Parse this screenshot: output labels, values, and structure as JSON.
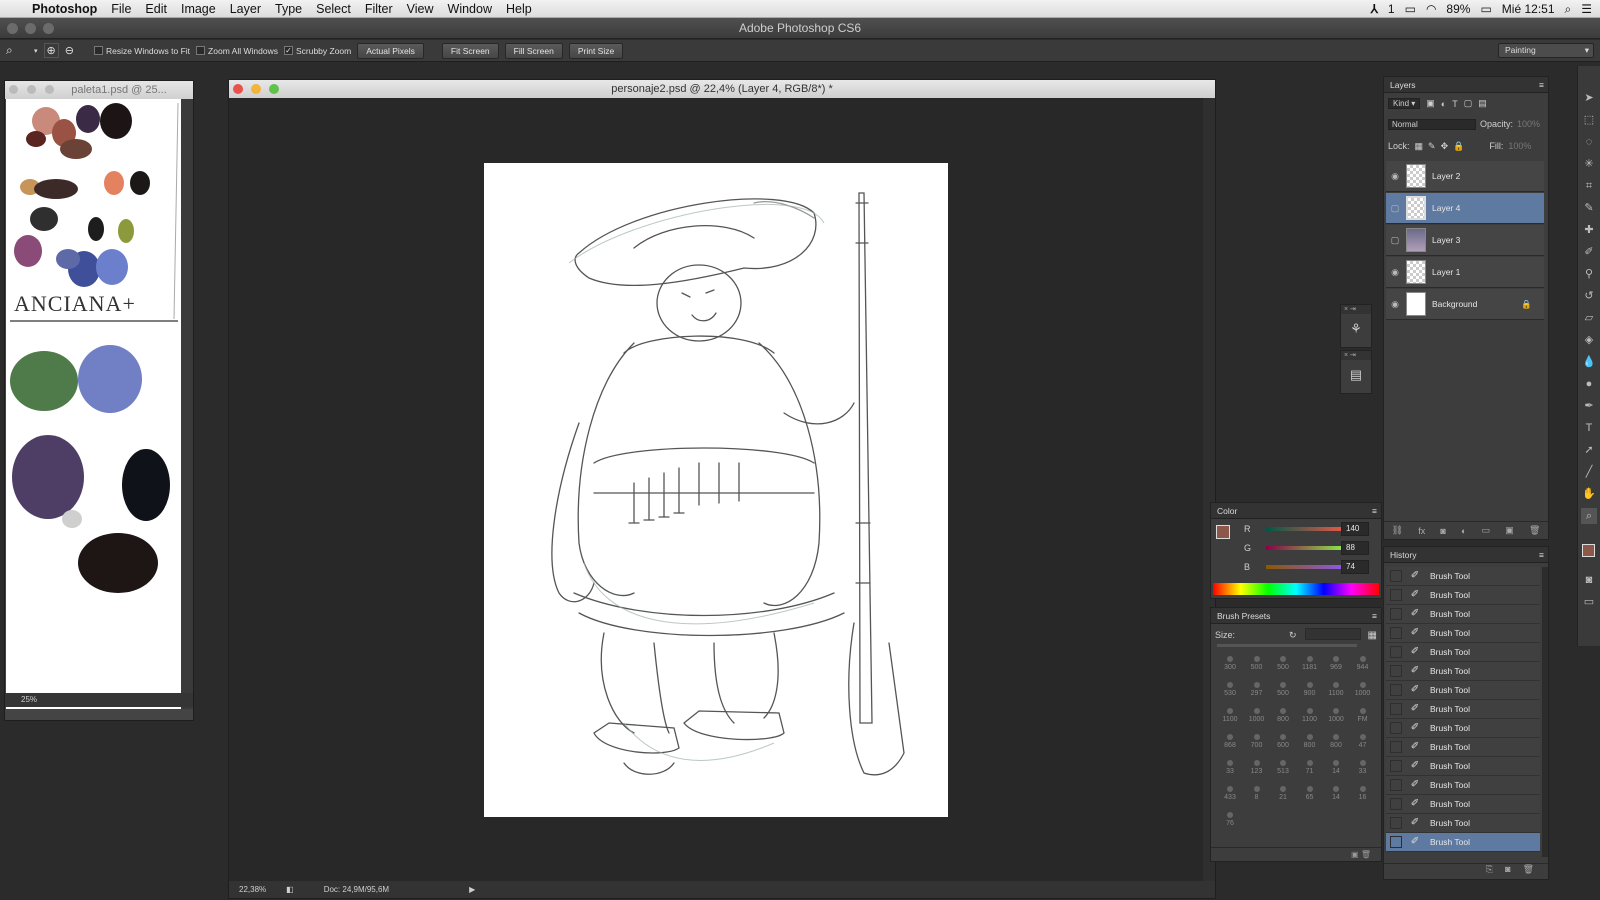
{
  "menubar": {
    "app": "Photoshop",
    "items": [
      "File",
      "Edit",
      "Image",
      "Layer",
      "Type",
      "Select",
      "Filter",
      "View",
      "Window",
      "Help"
    ],
    "status": {
      "battery": "89%",
      "clock": "Mié 12:51",
      "input": "1"
    }
  },
  "window": {
    "title": "Adobe Photoshop CS6"
  },
  "options": {
    "resize_windows": "Resize Windows to Fit",
    "zoom_all": "Zoom All Windows",
    "scrubby": "Scrubby Zoom",
    "actual_pixels": "Actual Pixels",
    "fit_screen": "Fit Screen",
    "fill_screen": "Fill Screen",
    "print_size": "Print Size",
    "workspace": "Painting"
  },
  "palette_doc": {
    "title": "paleta1.psd @ 25...",
    "zoom": "25%",
    "signature": "ANCIANA+"
  },
  "main_doc": {
    "title": "personaje2.psd @ 22,4% (Layer 4, RGB/8*) *",
    "zoom": "22,38%",
    "doc_info": "Doc: 24,9M/95,6M"
  },
  "layers": {
    "title": "Layers",
    "kind": "Kind",
    "blend": "Normal",
    "opacity_label": "Opacity:",
    "opacity": "100%",
    "lock_label": "Lock:",
    "fill_label": "Fill:",
    "fill": "100%",
    "items": [
      {
        "name": "Layer 2",
        "visible": true,
        "selected": false
      },
      {
        "name": "Layer 4",
        "visible": false,
        "selected": true
      },
      {
        "name": "Layer 3",
        "visible": false,
        "selected": false
      },
      {
        "name": "Layer 1",
        "visible": true,
        "selected": false
      },
      {
        "name": "Background",
        "visible": true,
        "selected": false,
        "locked": true
      }
    ]
  },
  "color": {
    "title": "Color",
    "r_label": "R",
    "g_label": "G",
    "b_label": "B",
    "r": "140",
    "g": "88",
    "b": "74",
    "fg": "#8c584a",
    "bg": "#ffffff"
  },
  "brush_presets": {
    "title": "Brush Presets",
    "size_label": "Size:",
    "rows": [
      [
        "300",
        "500",
        "500",
        "1181",
        "969",
        "944"
      ],
      [
        "530",
        "297",
        "500",
        "900",
        "1100",
        "1000"
      ],
      [
        "1100",
        "1000",
        "800",
        "1100",
        "1000",
        "FM"
      ],
      [
        "868",
        "700",
        "600",
        "800",
        "800",
        "47"
      ],
      [
        "33",
        "123",
        "513",
        "71",
        "14",
        "33"
      ],
      [
        "433",
        "8",
        "21",
        "65",
        "14",
        "16"
      ],
      [
        "76"
      ]
    ]
  },
  "history": {
    "title": "History",
    "items": [
      "Brush Tool",
      "Brush Tool",
      "Brush Tool",
      "Brush Tool",
      "Brush Tool",
      "Brush Tool",
      "Brush Tool",
      "Brush Tool",
      "Brush Tool",
      "Brush Tool",
      "Brush Tool",
      "Brush Tool",
      "Brush Tool",
      "Brush Tool",
      "Brush Tool"
    ]
  }
}
